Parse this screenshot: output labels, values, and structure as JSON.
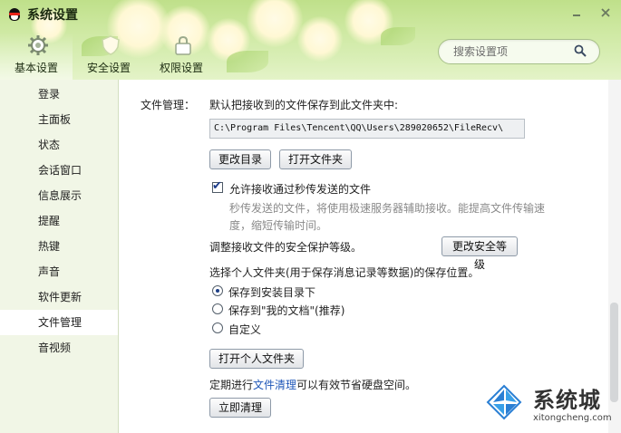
{
  "window": {
    "title": "系统设置",
    "logo_icon": "qq-penguin-icon",
    "controls": [
      "minimize-icon",
      "close-icon"
    ]
  },
  "tabs": [
    {
      "label": "基本设置",
      "icon": "gear-icon",
      "active": true
    },
    {
      "label": "安全设置",
      "icon": "shield-icon",
      "active": false
    },
    {
      "label": "权限设置",
      "icon": "lock-icon",
      "active": false
    }
  ],
  "search": {
    "placeholder": "搜索设置项",
    "value": "",
    "icon": "search-icon"
  },
  "sidebar": {
    "items": [
      {
        "label": "登录"
      },
      {
        "label": "主面板"
      },
      {
        "label": "状态"
      },
      {
        "label": "会话窗口"
      },
      {
        "label": "信息展示"
      },
      {
        "label": "提醒"
      },
      {
        "label": "热键"
      },
      {
        "label": "声音"
      },
      {
        "label": "软件更新"
      },
      {
        "label": "文件管理",
        "active": true
      },
      {
        "label": "音视频"
      }
    ]
  },
  "file_mgmt": {
    "section_label": "文件管理：",
    "save_desc": "默认把接收到的文件保存到此文件夹中:",
    "path": "C:\\Program Files\\Tencent\\QQ\\Users\\289020652\\FileRecv\\",
    "change_dir_btn": "更改目录",
    "open_folder_btn": "打开文件夹",
    "allow_label": "允许接收通过秒传发送的文件",
    "allow_checked": true,
    "allow_hint_line1": "秒传发送的文件，将使用极速服务器辅助接收。能提高文件传输速",
    "allow_hint_line2": "度，缩短传输时间。",
    "security_desc": "调整接收文件的安全保护等级。",
    "security_btn": "更改安全等级",
    "personal_desc": "选择个人文件夹(用于保存消息记录等数据)的保存位置。",
    "radio_options": [
      {
        "label": "保存到安装目录下",
        "checked": true
      },
      {
        "label": "保存到\"我的文档\"(推荐)",
        "checked": false
      },
      {
        "label": "自定义",
        "checked": false
      }
    ],
    "open_personal_btn": "打开个人文件夹",
    "cleanup_prefix": "定期进行",
    "cleanup_link": "文件清理",
    "cleanup_suffix": "可以有效节省硬盘空间。",
    "cleanup_btn": "立即清理"
  },
  "watermark": {
    "text": "系统城",
    "domain": "xitongcheng.com"
  },
  "colors": {
    "header_green": "#cde8a0",
    "sidebar_bg": "#f1f6e6",
    "link": "#1f57b8"
  }
}
